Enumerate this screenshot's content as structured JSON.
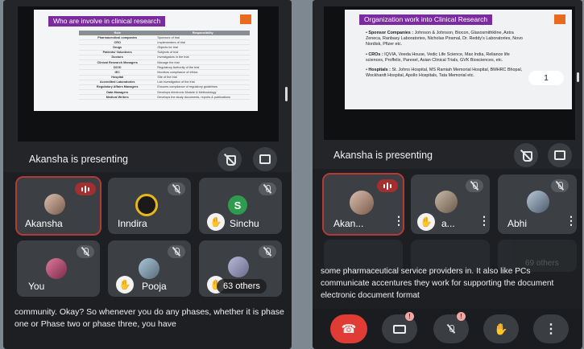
{
  "left": {
    "slide": {
      "title": "Who are involve in clinical research",
      "table_headers": [
        "Role",
        "Responsibility"
      ],
      "rows": [
        [
          "Pharmaceutical companies",
          "Sponsors of trial"
        ],
        [
          "CRO",
          "Implementers of trial"
        ],
        [
          "Drugs",
          "Objects for trial"
        ],
        [
          "Patients/ Volunteers",
          "Subjects of trial"
        ],
        [
          "Doctors",
          "Investigators in the trial"
        ],
        [
          "Clinical Research Managers",
          "Manage the trial"
        ],
        [
          "DCGI",
          "Regulatory Authority of the trial"
        ],
        [
          "IEC",
          "Monitors compliance of ethics"
        ],
        [
          "Hospital",
          "Site of the trial"
        ],
        [
          "Accredited Laboratories",
          "Lab investigation of the trial"
        ],
        [
          "Regulatory Affairs Managers",
          "Ensures compliance of regulatory guidelines"
        ],
        [
          "Data Managers",
          "Develops electronic Module & Methodology"
        ],
        [
          "Medical Writers",
          "Develops the study documents, reports & publications"
        ]
      ]
    },
    "presenting_label": "Akansha is presenting",
    "tiles": [
      {
        "name": "Akansha"
      },
      {
        "name": "Inndira"
      },
      {
        "name": "Sinchu",
        "letter": "S"
      },
      {
        "name": "You"
      },
      {
        "name": "Pooja"
      },
      {
        "name": "63 others"
      }
    ],
    "caption": "community. Okay? So whenever you do any phases, whether it is phase one or Phase two or phase three, you have"
  },
  "right": {
    "slide": {
      "title": "Organization work into Clinical Research",
      "bullets": [
        {
          "head": "Sponsor Companies :",
          "text": "Johnson & Johnson, Biocon, Glaxosmithkline, Astra Zeneca, Ranbaxy Laboratories, Nicholas Piramal, Dr. Reddy's Laboratories, Novo Nordisk, Pfizer etc."
        },
        {
          "head": "CROs :",
          "text": "IQVIA, Veeda House, Vedic Life Science, Max India, Reliance life sciences, Proffelix, Parexel, Asian Clinical Trials, GVK Biosciences, etc."
        },
        {
          "head": "Hospitals :",
          "text": "St. Johns Hospital, MS Ramiah Memorial Hospital, BMHRC Bhopal, Wockhardt Hospital, Apollo Hospitals, Tata Memorial etc."
        }
      ],
      "page_indicator": "1"
    },
    "presenting_label": "Akansha is presenting",
    "tiles": [
      {
        "name": "Akan..."
      },
      {
        "name": "a..."
      },
      {
        "name": "Abhi"
      }
    ],
    "others_faint": "69 others",
    "caption": "some pharmaceutical service providers in. It also like PCs communicate accentures they work for supporting the document electronic document format",
    "alert_badge": "!"
  }
}
